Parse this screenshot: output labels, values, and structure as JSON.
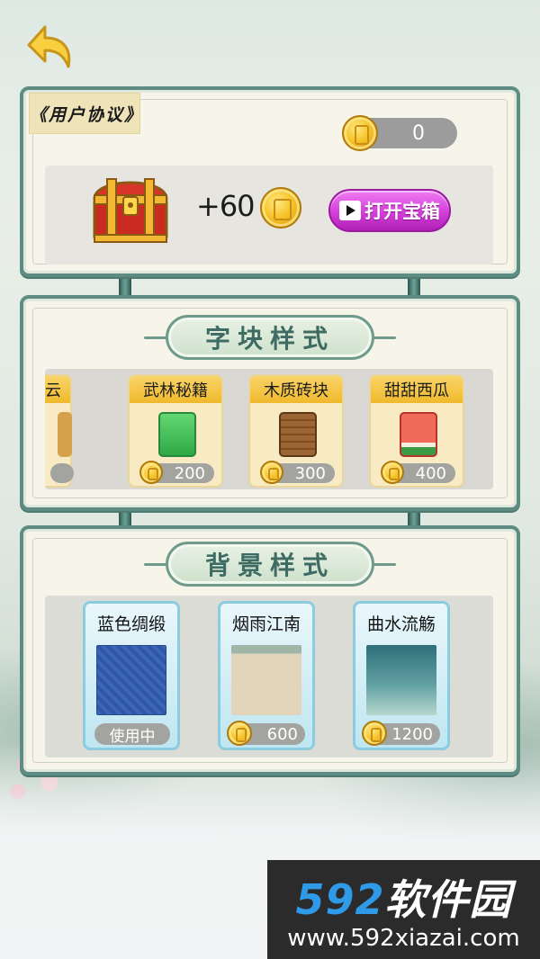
{
  "top": {
    "agreement_label": "《用户协议》",
    "coin_balance": "0",
    "reward_text": "+60",
    "open_chest_label": "打开宝箱"
  },
  "block_styles": {
    "title": "字块样式",
    "items": [
      {
        "name": "云",
        "price": "",
        "tile_color": "#d5a14a"
      },
      {
        "name": "武林秘籍",
        "price": "200",
        "tile_color": "#49c25a"
      },
      {
        "name": "木质砖块",
        "price": "300",
        "tile_color": "#8b5a2b"
      },
      {
        "name": "甜甜西瓜",
        "price": "400",
        "tile_color": "#e9473f"
      }
    ]
  },
  "background_styles": {
    "title": "背景样式",
    "items": [
      {
        "name": "蓝色绸缎",
        "status": "使用中"
      },
      {
        "name": "烟雨江南",
        "price": "600"
      },
      {
        "name": "曲水流觞",
        "price": "1200"
      }
    ]
  },
  "watermark": {
    "brand_num": "592",
    "brand_text": "软件园",
    "url": "www.592xiazai.com"
  }
}
